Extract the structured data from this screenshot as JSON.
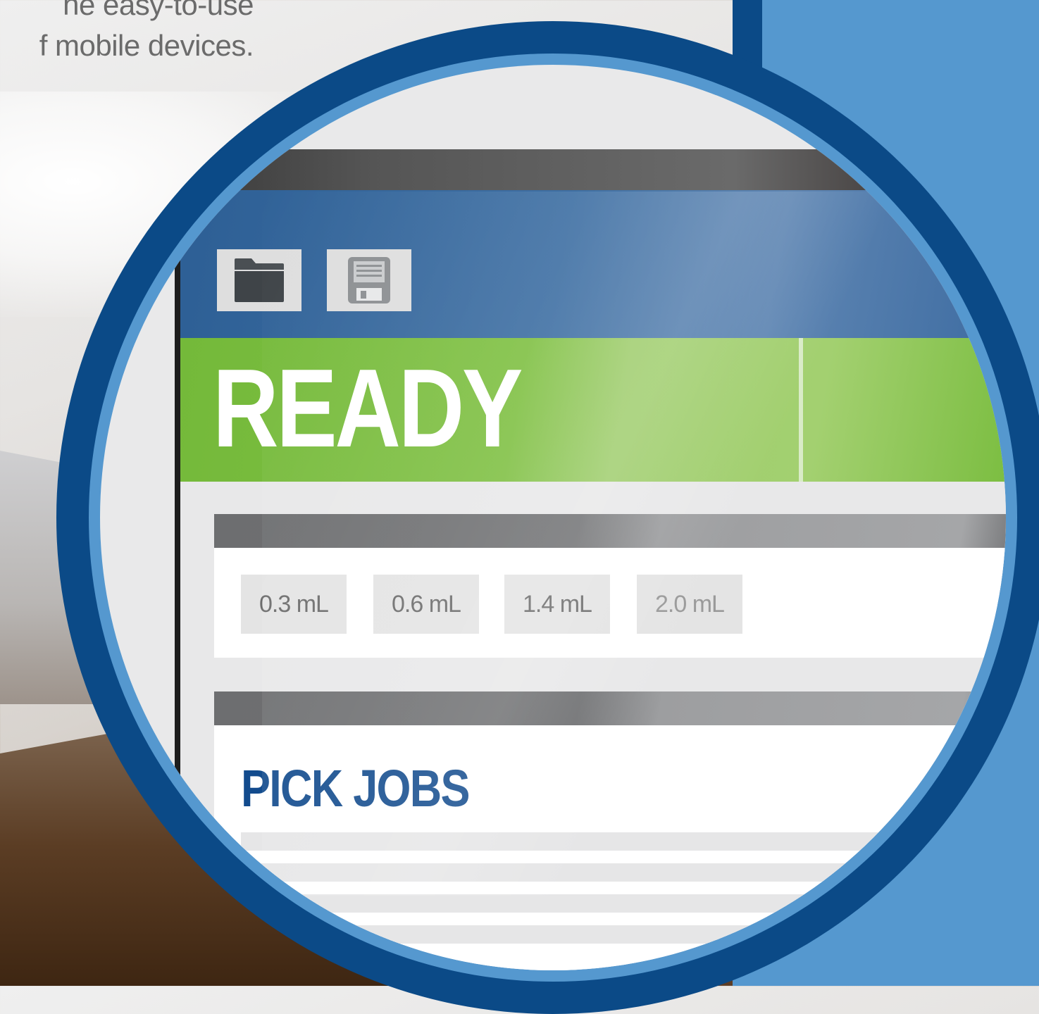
{
  "intro": {
    "line1": "he easy-to-use",
    "line2": "f mobile devices."
  },
  "toolbar": {
    "open_icon": "folder-icon",
    "save_icon": "floppy-disk-icon"
  },
  "status": {
    "label": "READY",
    "color": "#7fc043"
  },
  "volumes": {
    "options": [
      "0.3 mL",
      "0.6 mL",
      "1.4 mL",
      "2.0 mL"
    ]
  },
  "pick_jobs": {
    "title": "PICK JOBS",
    "title_color": "#124b8d"
  },
  "colors": {
    "brand_blue": "#0b4a87",
    "panel_blue": "#5598cf",
    "header_blue": "#3e6fa3"
  }
}
